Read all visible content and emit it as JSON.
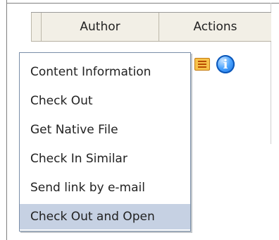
{
  "table": {
    "columns": [
      "Author",
      "Actions"
    ]
  },
  "row": {
    "action_icons": [
      "document-list-icon",
      "info-icon"
    ]
  },
  "context_menu": {
    "items": [
      "Content Information",
      "Check Out",
      "Get Native File",
      "Check In Similar",
      "Send link by e-mail",
      "Check Out and Open"
    ],
    "selected_index": 5,
    "highlight_color": "#c6d1e3"
  },
  "info_icon_glyph": "i"
}
